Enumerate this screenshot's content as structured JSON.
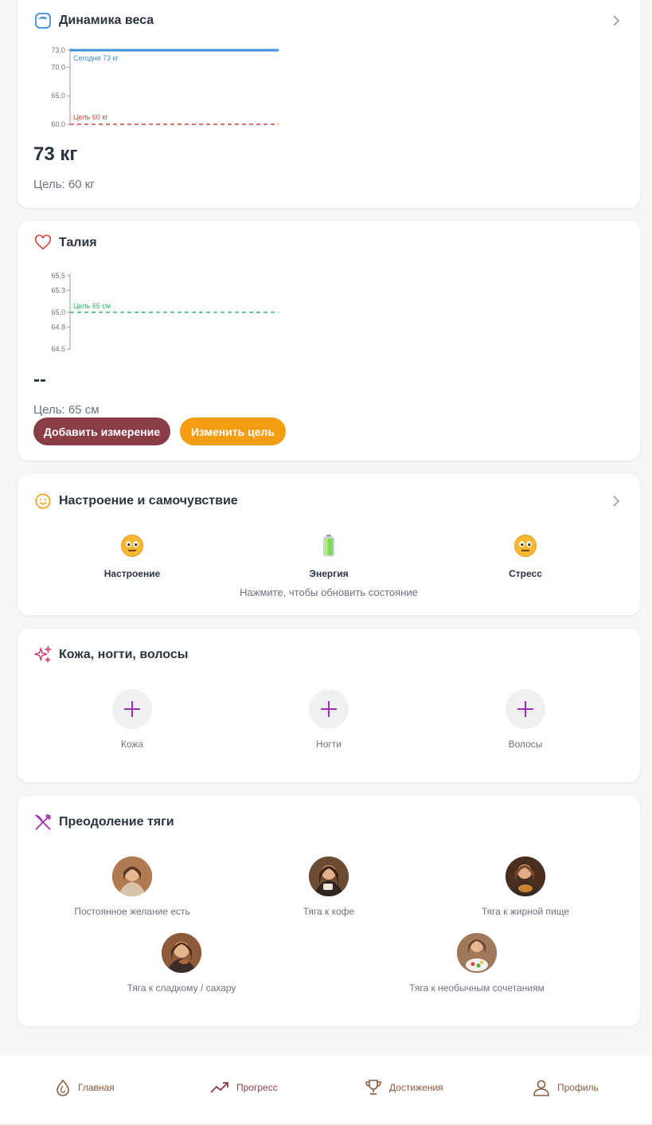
{
  "colors": {
    "accent_blue": "#3a8fd9",
    "goal_red": "#d9473b",
    "goal_green": "#2db56a",
    "btn_primary": "#8b3d45",
    "btn_secondary": "#f29d12",
    "purple": "#9b2fb0",
    "nav_brown": "#8a5a3c"
  },
  "weight": {
    "title": "Динамика веса",
    "icon": "scale-icon",
    "chart_data": {
      "type": "line",
      "yticks": [
        "73.0",
        "70.0",
        "65.0",
        "60.0"
      ],
      "ylim": [
        60,
        73
      ],
      "lines": [
        {
          "name": "Сегодня 73 кг",
          "value": 73,
          "color": "#3a8fd9",
          "style": "solid"
        },
        {
          "name": "Цель 60 кг",
          "value": 60,
          "color": "#d9473b",
          "style": "dashed"
        }
      ]
    },
    "value": "73 кг",
    "goal": "Цель: 60 кг"
  },
  "waist": {
    "title": "Талия",
    "icon": "heart-icon",
    "chart_data": {
      "type": "line",
      "yticks": [
        "65.5",
        "65.3",
        "65.0",
        "64.8",
        "64.5"
      ],
      "ylim": [
        64.5,
        65.5
      ],
      "lines": [
        {
          "name": "Цель 65 см",
          "value": 65.0,
          "color": "#2db56a",
          "style": "dashed"
        }
      ]
    },
    "value": "--",
    "goal": "Цель: 65 см",
    "add_button": "Добавить измерение",
    "change_button": "Изменить цель"
  },
  "mood": {
    "title": "Настроение и самочувствие",
    "icon": "smile-icon",
    "items": [
      {
        "label": "Настроение",
        "icon": "neutral-face-icon"
      },
      {
        "label": "Энергия",
        "icon": "battery-icon"
      },
      {
        "label": "Стресс",
        "icon": "neutral-face-icon"
      }
    ],
    "hint": "Нажмите, чтобы обновить состояние"
  },
  "beauty": {
    "title": "Кожа, ногти, волосы",
    "icon": "sparkles-icon",
    "items": [
      {
        "label": "Кожа"
      },
      {
        "label": "Ногти"
      },
      {
        "label": "Волосы"
      }
    ]
  },
  "cravings": {
    "title": "Преодоление тяги",
    "icon": "utensils-icon",
    "items": [
      {
        "label": "Постоянное желание есть"
      },
      {
        "label": "Тяга к кофе"
      },
      {
        "label": "Тяга к жирной пище"
      },
      {
        "label": "Тяга к сладкому / сахару"
      },
      {
        "label": "Тяга к необычным сочетаниям"
      }
    ]
  },
  "nav": {
    "items": [
      {
        "label": "Главная",
        "icon": "drop-icon"
      },
      {
        "label": "Прогресс",
        "icon": "trending-up-icon"
      },
      {
        "label": "Достижения",
        "icon": "trophy-icon"
      },
      {
        "label": "Профиль",
        "icon": "user-icon"
      }
    ]
  }
}
